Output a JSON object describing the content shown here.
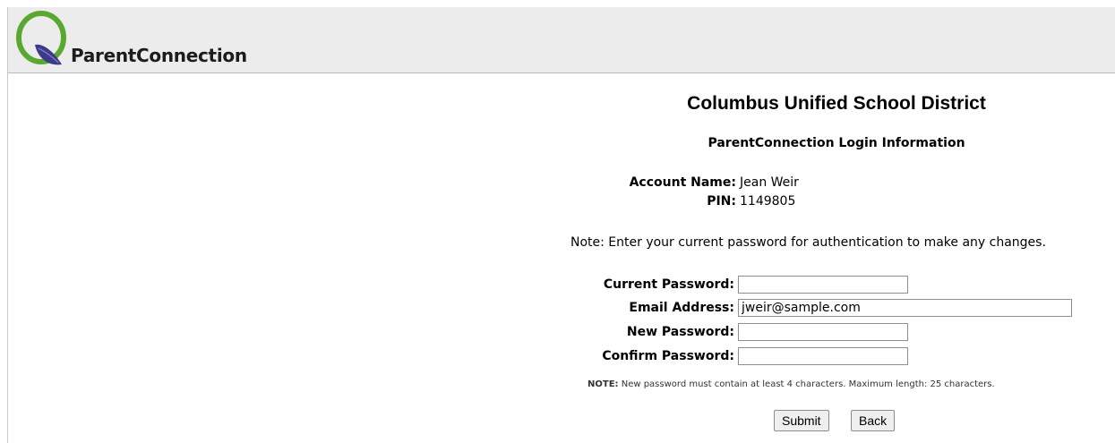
{
  "header": {
    "logo_text": "ParentConnection",
    "logo_color_ring": "#5aa832",
    "logo_color_leaf": "#3b3a8c"
  },
  "page": {
    "district_title": "Columbus Unified School District",
    "subtitle": "ParentConnection Login Information"
  },
  "account": {
    "name_label": "Account Name:",
    "name_value": "Jean Weir",
    "pin_label": "PIN:",
    "pin_value": "1149805"
  },
  "note": "Note: Enter your current password for authentication to make any changes.",
  "form": {
    "current_password_label": "Current Password:",
    "current_password_value": "",
    "email_label": "Email Address:",
    "email_value": "jweir@sample.com",
    "new_password_label": "New Password:",
    "new_password_value": "",
    "confirm_password_label": "Confirm Password:",
    "confirm_password_value": "",
    "password_note_prefix": "NOTE:",
    "password_note_text": " New password must contain at least 4 characters. Maximum length: 25 characters."
  },
  "buttons": {
    "submit": "Submit",
    "back": "Back"
  }
}
